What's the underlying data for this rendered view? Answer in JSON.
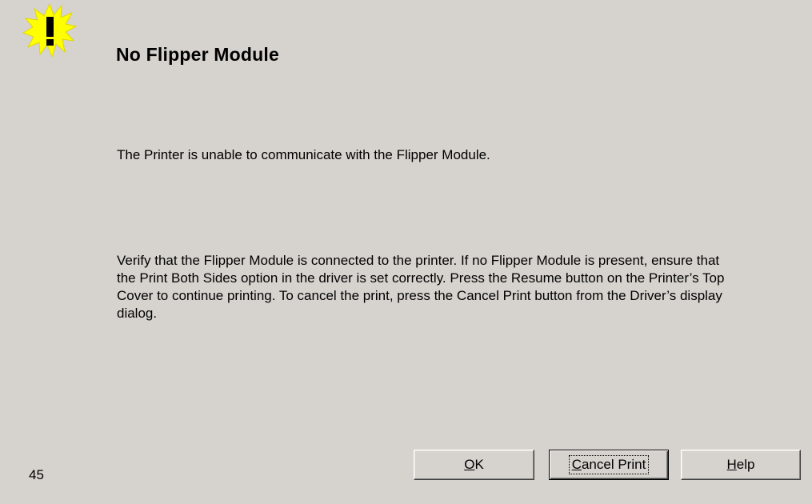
{
  "dialog": {
    "icon": "warning-exclamation-icon",
    "title": "No Flipper Module",
    "message": "The Printer is unable to communicate with the Flipper Module.",
    "details": "Verify that the Flipper Module is connected to the printer. If no Flipper Module is present, ensure that the Print Both Sides option in the driver is set correctly. Press the Resume button on the Printer’s Top Cover to continue printing. To cancel the print, press the Cancel Print button from the Driver’s display dialog.",
    "error_code": "45"
  },
  "buttons": {
    "ok": {
      "mnemonic": "O",
      "rest": "K"
    },
    "cancel_print": {
      "mnemonic": "C",
      "rest": "ancel Print"
    },
    "help": {
      "mnemonic": "H",
      "rest": "elp"
    }
  },
  "colors": {
    "background": "#d6d3ce",
    "icon_burst": "#ffff00"
  }
}
